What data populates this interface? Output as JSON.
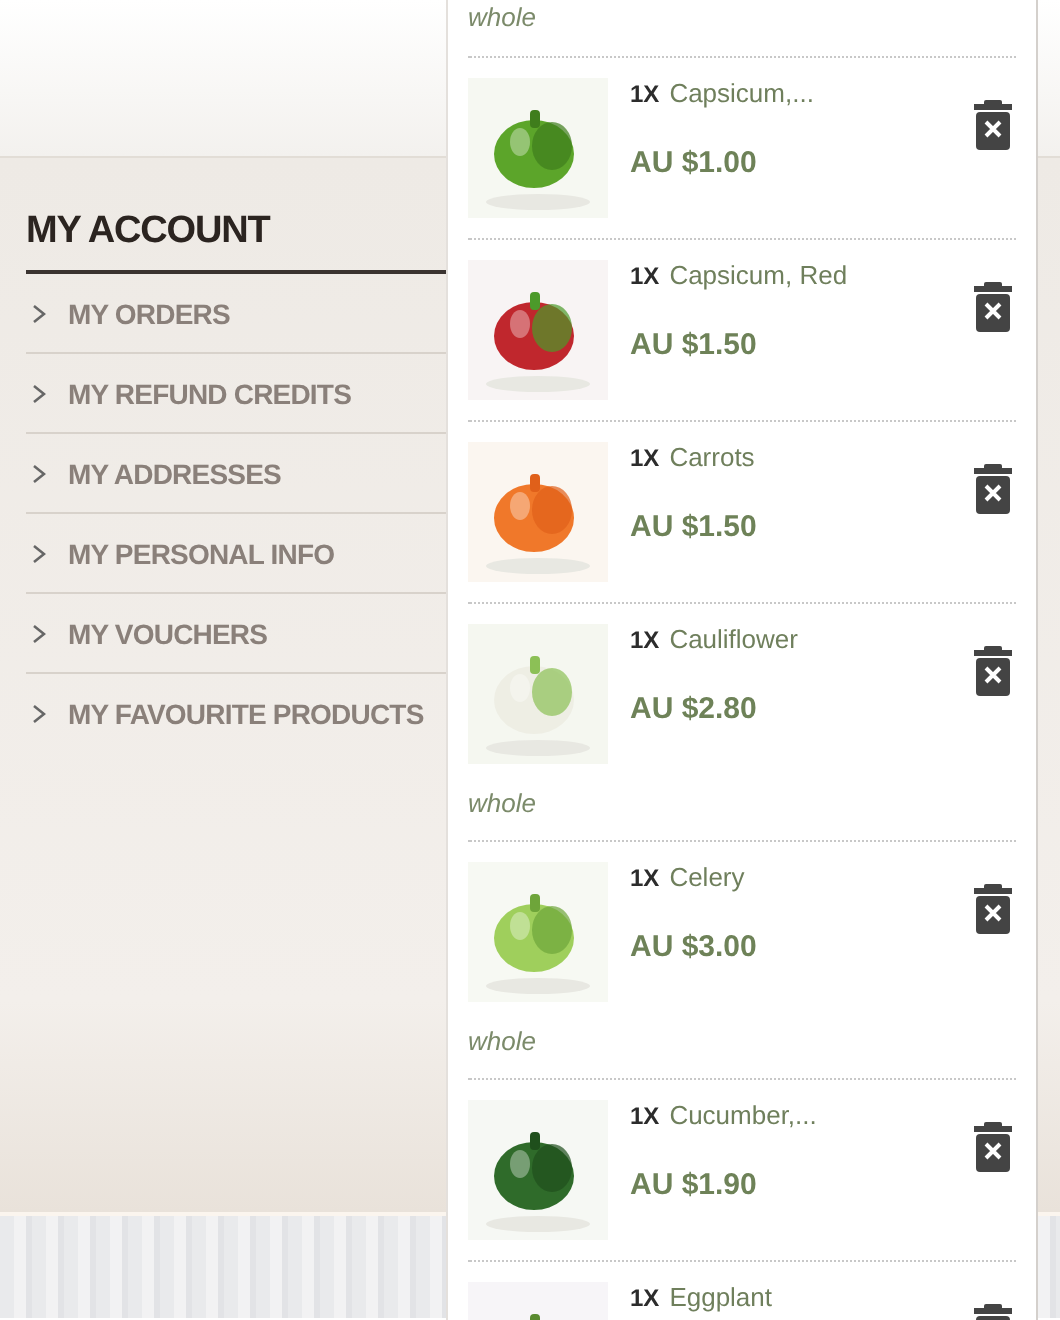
{
  "sidebar": {
    "title": "MY ACCOUNT",
    "items": [
      {
        "label": "MY ORDERS"
      },
      {
        "label": "MY REFUND CREDITS"
      },
      {
        "label": "MY ADDRESSES"
      },
      {
        "label": "MY PERSONAL INFO"
      },
      {
        "label": "MY VOUCHERS"
      },
      {
        "label": "MY FAVOURITE PRODUCTS"
      }
    ]
  },
  "cart": {
    "leading_note": "whole",
    "items": [
      {
        "quantity": "1X",
        "name": "Capsicum,...",
        "price": "AU $1.00"
      },
      {
        "quantity": "1X",
        "name": "Capsicum, Red",
        "price": "AU $1.50"
      },
      {
        "quantity": "1X",
        "name": "Carrots",
        "price": "AU $1.50"
      },
      {
        "quantity": "1X",
        "name": "Cauliflower",
        "price": "AU $2.80",
        "note": "whole"
      },
      {
        "quantity": "1X",
        "name": "Celery",
        "price": "AU $3.00",
        "note": "whole"
      },
      {
        "quantity": "1X",
        "name": "Cucumber,...",
        "price": "AU $1.90"
      },
      {
        "quantity": "1X",
        "name": "Eggplant"
      }
    ]
  }
}
